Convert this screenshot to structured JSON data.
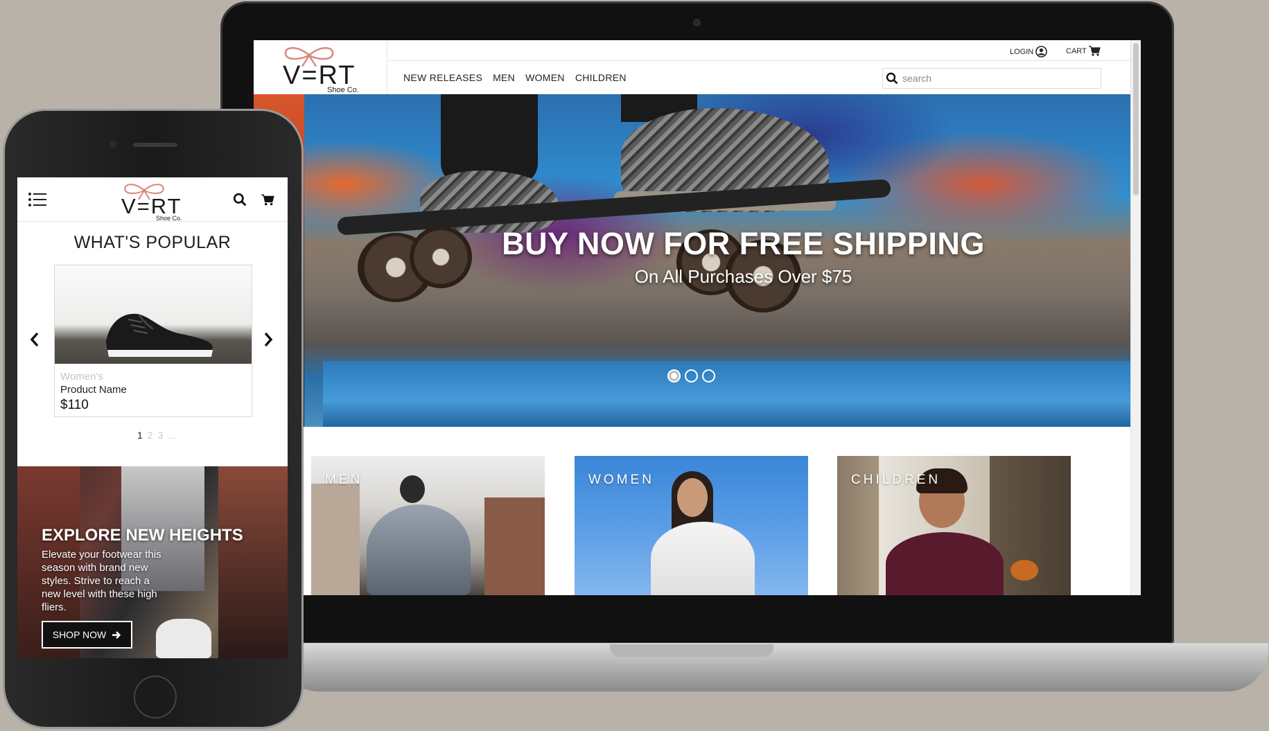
{
  "brand": {
    "name": "V=RT",
    "tagline": "Shoe Co.",
    "bow_color": "#d9877f"
  },
  "desktop": {
    "topbar": {
      "login_label": "LOGIN",
      "cart_label": "CART"
    },
    "nav": [
      "NEW RELEASES",
      "MEN",
      "WOMEN",
      "CHILDREN"
    ],
    "search": {
      "placeholder": "search"
    },
    "hero": {
      "title": "BUY NOW FOR FREE SHIPPING",
      "subtitle": "On All Purchases Over $75",
      "slides": 3,
      "active_slide": 1
    },
    "categories": [
      {
        "label": "MEN"
      },
      {
        "label": "WOMEN"
      },
      {
        "label": "CHILDREN"
      }
    ]
  },
  "mobile": {
    "popular_title": "WHAT'S POPULAR",
    "product": {
      "category": "Women's",
      "name": "Product Name",
      "price": "$110"
    },
    "pagination": [
      "1",
      "2",
      "3",
      "..."
    ],
    "active_page": "1",
    "explore": {
      "title": "EXPLORE NEW HEIGHTS",
      "text": "Elevate your footwear this season with brand new styles. Strive to reach a new level with these high fliers.",
      "button_label": "SHOP NOW"
    }
  },
  "colors": {
    "background": "#b8b2a8",
    "device_dark": "#111111",
    "text_dark": "#222222"
  }
}
